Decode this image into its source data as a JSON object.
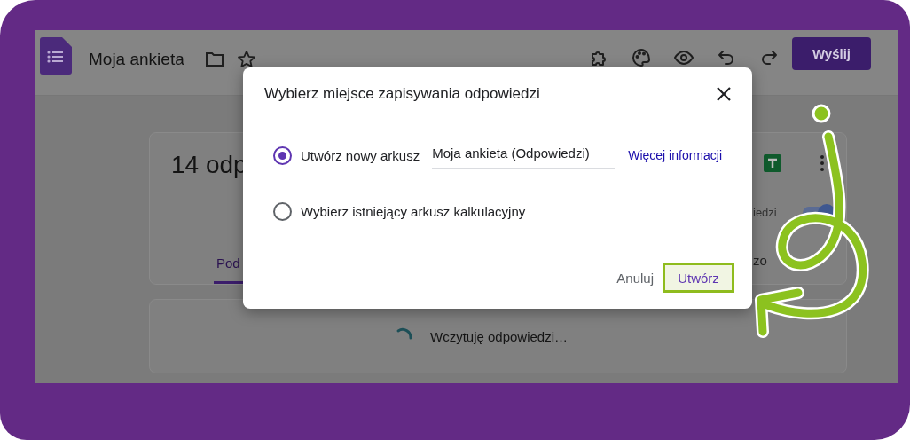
{
  "app": {
    "title": "Moja ankieta",
    "send_button": "Wyślij"
  },
  "summary_card": {
    "heading": "14 odp",
    "tabs": [
      {
        "label": "Pod",
        "selected": true
      }
    ],
    "toggle_label": "iedzi",
    "toggle_on": true,
    "trailing_text": "zo"
  },
  "loading": {
    "text": "Wczytuję odpowiedzi…"
  },
  "dialog": {
    "title": "Wybierz miejsce zapisywania odpowiedzi",
    "options": [
      {
        "kind": "new",
        "label": "Utwórz nowy arkusz",
        "selected": true,
        "field_value": "Moja ankieta (Odpowiedzi)",
        "link": "Więcej informacji"
      },
      {
        "kind": "existing",
        "label": "Wybierz istniejący arkusz kalkulacyjny",
        "selected": false
      }
    ],
    "cancel_button": "Anuluj",
    "confirm_button": "Utwórz",
    "confirm_highlighted": true
  }
}
